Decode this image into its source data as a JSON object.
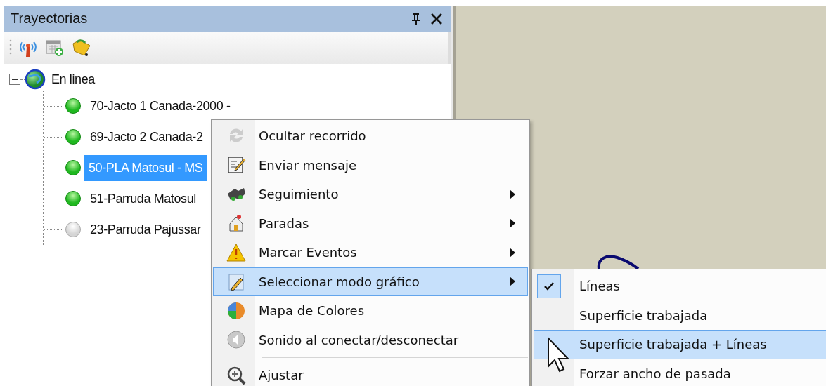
{
  "panel": {
    "title": "Trayectorias"
  },
  "tree": [
    {
      "label": "En linea",
      "expanded": true,
      "children": [
        {
          "label": "70-Jacto 1 Canada-2000 -",
          "online": true,
          "selected": false
        },
        {
          "label": "69-Jacto 2 Canada-2",
          "online": true,
          "selected": false
        },
        {
          "label": "50-PLA Matosul - MS",
          "online": true,
          "selected": true
        },
        {
          "label": "51-Parruda Matosul",
          "online": true,
          "selected": false
        },
        {
          "label": "23-Parruda Pajussar",
          "online": false,
          "selected": false
        }
      ]
    }
  ],
  "context_menu": {
    "items": [
      {
        "kind": "item",
        "label": "Ocultar recorrido",
        "submenu": false,
        "selected": false
      },
      {
        "kind": "item",
        "label": "Enviar mensaje",
        "submenu": false,
        "selected": false
      },
      {
        "kind": "item",
        "label": "Seguimiento",
        "submenu": true,
        "selected": false
      },
      {
        "kind": "item",
        "label": "Paradas",
        "submenu": true,
        "selected": false
      },
      {
        "kind": "item",
        "label": "Marcar Eventos",
        "submenu": true,
        "selected": false
      },
      {
        "kind": "item",
        "label": "Seleccionar modo gráfico",
        "submenu": true,
        "selected": true
      },
      {
        "kind": "item",
        "label": "Mapa de Colores",
        "submenu": false,
        "selected": false
      },
      {
        "kind": "item",
        "label": "Sonido al conectar/desconectar",
        "submenu": false,
        "selected": false
      },
      {
        "kind": "separator"
      },
      {
        "kind": "item",
        "label": "Ajustar",
        "submenu": false,
        "selected": false
      }
    ]
  },
  "submenu": {
    "items": [
      {
        "label": "Líneas",
        "checked": true,
        "selected": false
      },
      {
        "label": "Superficie trabajada",
        "checked": false,
        "selected": false
      },
      {
        "label": "Superficie trabajada + Líneas",
        "checked": false,
        "selected": true
      },
      {
        "label": "Forzar ancho de pasada",
        "checked": false,
        "selected": false
      }
    ]
  }
}
